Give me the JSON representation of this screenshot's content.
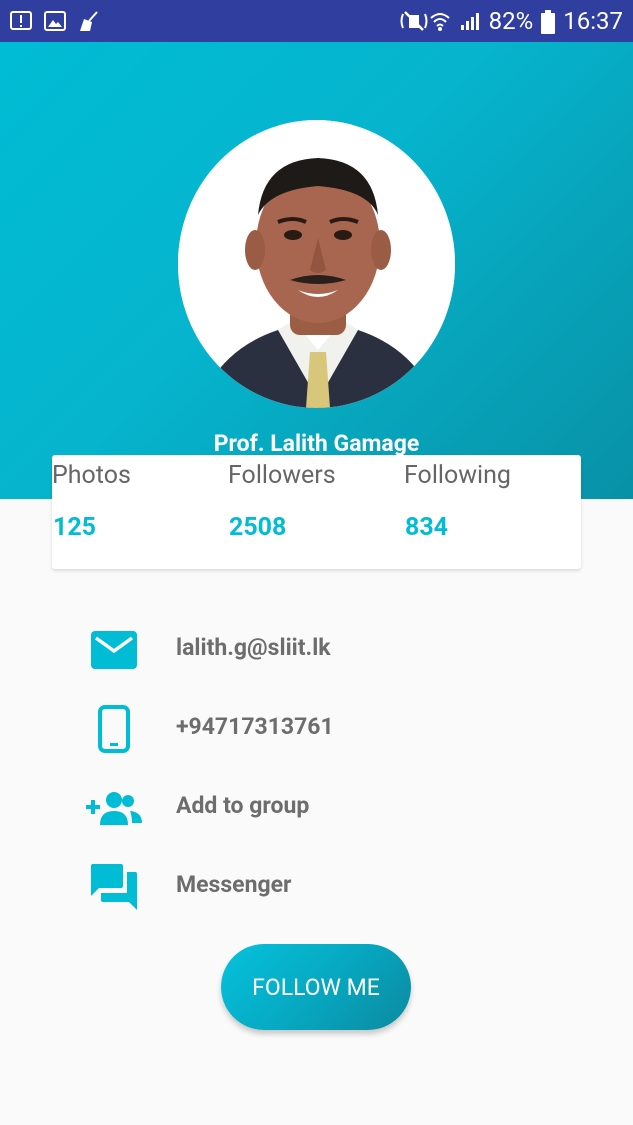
{
  "status_bar": {
    "battery": "82%",
    "time": "16:37",
    "icons_left": [
      "alert-icon",
      "image-icon",
      "broom-icon"
    ],
    "icons_right": [
      "mute-icon",
      "wifi-icon",
      "signal-icon",
      "battery-icon"
    ]
  },
  "profile": {
    "name": "Prof. Lalith Gamage",
    "avatar": "profile-photo"
  },
  "stats": [
    {
      "label": "Photos",
      "value": "125"
    },
    {
      "label": "Followers",
      "value": "2508"
    },
    {
      "label": "Following",
      "value": "834"
    }
  ],
  "contacts": [
    {
      "icon": "email-icon",
      "text": "lalith.g@sliit.lk"
    },
    {
      "icon": "phone-icon",
      "text": "+94717313761"
    },
    {
      "icon": "add-group-icon",
      "text": "Add to group"
    },
    {
      "icon": "messenger-icon",
      "text": "Messenger"
    }
  ],
  "follow_button": {
    "label": "FOLLOW ME"
  },
  "colors": {
    "accent": "#00bcd4",
    "status_bar": "#303f9f",
    "text_secondary": "#6d6d6d"
  }
}
